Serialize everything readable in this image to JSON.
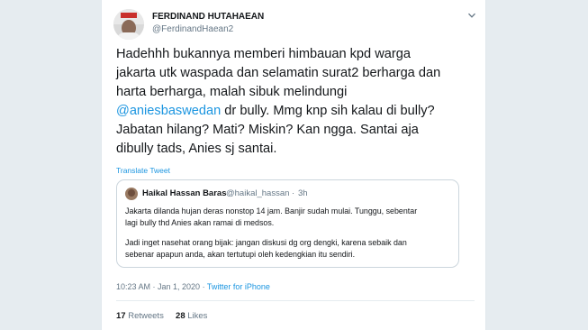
{
  "author": {
    "name": "FERDINAND HUTAHAEAN",
    "handle": "@FerdinandHaean2"
  },
  "tweet": {
    "line1": "Hadehhh bukannya memberi himbauan kpd warga",
    "line2": "jakarta utk waspada dan selamatin surat2 berharga dan",
    "line3": "harta berharga, malah sibuk melindungi",
    "mention": "@aniesbaswedan",
    "line4_rest": " dr bully. Mmg knp sih kalau di bully?",
    "line5": "Jabatan hilang? Mati? Miskin? Kan ngga. Santai aja",
    "line6": "dibully tads, Anies sj santai.",
    "translate_label": "Translate Tweet"
  },
  "quoted": {
    "name": "Haikal Hassan Baras",
    "handle": "@haikal_hassan",
    "separator": "·",
    "time": "3h",
    "line1": "Jakarta dilanda hujan deras nonstop 14 jam. Banjir sudah mulai. Tunggu, sebentar",
    "line2": "lagi bully thd Anies akan ramai di medsos.",
    "line3": "Jadi inget nasehat orang bijak:  jangan diskusi dg org dengki, karena sebaik dan",
    "line4": "sebenar apapun anda, akan tertutupi oleh kedengkian itu sendiri."
  },
  "meta": {
    "timestamp": "10:23 AM · Jan 1, 2020 · ",
    "source": "Twitter for iPhone"
  },
  "stats": {
    "retweets_count": "17",
    "retweets_label": "Retweets",
    "likes_count": "28",
    "likes_label": "Likes"
  },
  "icons": {
    "caret": "chevron-down-icon"
  }
}
